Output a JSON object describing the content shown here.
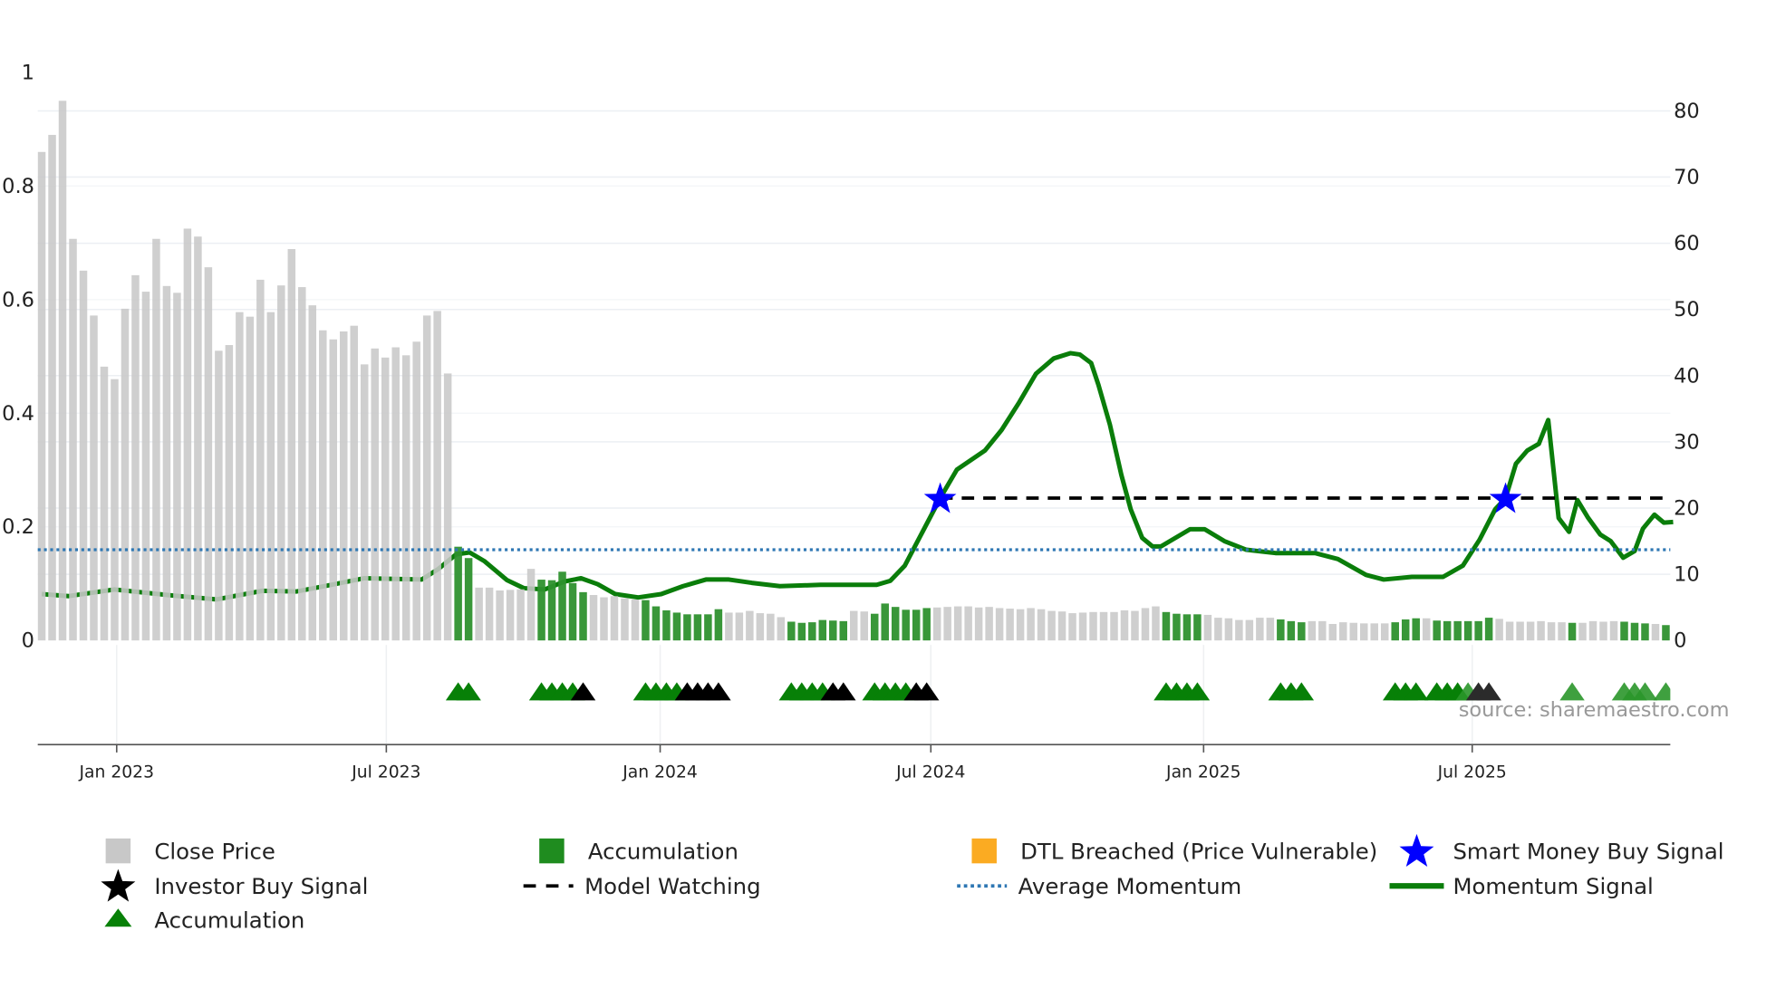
{
  "chart_data": {
    "type": "bar",
    "title": "",
    "left_axis": {
      "range": [
        0,
        1
      ],
      "ticks": [
        0,
        0.2,
        0.4,
        0.6,
        0.8,
        1
      ],
      "tick_labels": [
        "0",
        "0.2",
        "0.4",
        "0.6",
        "0.8",
        "1"
      ]
    },
    "right_axis": {
      "range": [
        0,
        80
      ],
      "ticks": [
        0,
        10,
        20,
        30,
        40,
        50,
        60,
        70,
        80
      ],
      "tick_labels": [
        "0",
        "10",
        "20",
        "30",
        "40",
        "50",
        "60",
        "70",
        "80"
      ]
    },
    "x_axis": {
      "unit": "week index",
      "ticks": [
        {
          "label": "Jan 2023",
          "week": 7.2
        },
        {
          "label": "Jul 2023",
          "week": 33.1
        },
        {
          "label": "Jan 2024",
          "week": 59.4
        },
        {
          "label": "Jul 2024",
          "week": 85.4
        },
        {
          "label": "Jan 2025",
          "week": 111.6
        },
        {
          "label": "Jul 2025",
          "week": 137.4
        }
      ]
    },
    "close_price": [
      0.86,
      0.89,
      0.95,
      0.707,
      0.651,
      0.572,
      0.482,
      0.46,
      0.584,
      0.643,
      0.614,
      0.707,
      0.624,
      0.612,
      0.725,
      0.711,
      0.657,
      0.51,
      0.52,
      0.578,
      0.57,
      0.635,
      0.578,
      0.625,
      0.689,
      0.622,
      0.59,
      0.546,
      0.53,
      0.544,
      0.554,
      0.486,
      0.514,
      0.498,
      0.516,
      0.502,
      0.526,
      0.572,
      0.58,
      0.47,
      0.165,
      0.145,
      0.093,
      0.093,
      0.088,
      0.089,
      0.09,
      0.126,
      0.107,
      0.106,
      0.121,
      0.101,
      0.085,
      0.08,
      0.076,
      0.078,
      0.074,
      0.072,
      0.071,
      0.06,
      0.053,
      0.049,
      0.046,
      0.046,
      0.046,
      0.055,
      0.049,
      0.049,
      0.052,
      0.048,
      0.047,
      0.041,
      0.033,
      0.031,
      0.032,
      0.036,
      0.035,
      0.034,
      0.052,
      0.051,
      0.047,
      0.065,
      0.059,
      0.054,
      0.054,
      0.057,
      0.058,
      0.059,
      0.06,
      0.06,
      0.058,
      0.059,
      0.057,
      0.056,
      0.055,
      0.057,
      0.055,
      0.052,
      0.051,
      0.048,
      0.049,
      0.05,
      0.05,
      0.05,
      0.053,
      0.052,
      0.057,
      0.06,
      0.05,
      0.047,
      0.046,
      0.046,
      0.045,
      0.04,
      0.039,
      0.036,
      0.036,
      0.04,
      0.04,
      0.037,
      0.034,
      0.032,
      0.034,
      0.034,
      0.029,
      0.032,
      0.031,
      0.03,
      0.03,
      0.03,
      0.032,
      0.037,
      0.039,
      0.039,
      0.035,
      0.034,
      0.034,
      0.034,
      0.034,
      0.04,
      0.038,
      0.033,
      0.033,
      0.033,
      0.034,
      0.032,
      0.032,
      0.031,
      0.031,
      0.034,
      0.033,
      0.034,
      0.033,
      0.031,
      0.03,
      0.029,
      0.027
    ],
    "accumulation_weeks": [
      40,
      41,
      48,
      49,
      50,
      51,
      52,
      58,
      59,
      60,
      61,
      62,
      63,
      64,
      65,
      72,
      73,
      74,
      75,
      76,
      77,
      80,
      81,
      82,
      83,
      84,
      85,
      108,
      109,
      110,
      111,
      119,
      120,
      121,
      130,
      131,
      132,
      134,
      135,
      136,
      137,
      138,
      139,
      147,
      152,
      153,
      154,
      156
    ],
    "momentum_signal": [
      [
        0,
        7.0
      ],
      [
        2.6,
        6.7
      ],
      [
        7.0,
        7.7
      ],
      [
        12.5,
        6.8
      ],
      [
        16.8,
        6.2
      ],
      [
        21.2,
        7.5
      ],
      [
        24.5,
        7.4
      ],
      [
        27.8,
        8.4
      ],
      [
        31.0,
        9.4
      ],
      [
        36.5,
        9.2
      ],
      [
        38.1,
        10.8
      ],
      [
        39.8,
        13.0
      ],
      [
        41.1,
        13.3
      ],
      [
        42.5,
        12.0
      ],
      [
        44.7,
        9.1
      ],
      [
        46.3,
        7.9
      ],
      [
        48.3,
        7.7
      ],
      [
        50.2,
        8.9
      ],
      [
        51.8,
        9.4
      ],
      [
        53.4,
        8.5
      ],
      [
        55.1,
        7.0
      ],
      [
        57.3,
        6.5
      ],
      [
        59.5,
        7.0
      ],
      [
        61.6,
        8.2
      ],
      [
        63.8,
        9.2
      ],
      [
        66.0,
        9.2
      ],
      [
        68.2,
        8.7
      ],
      [
        70.9,
        8.2
      ],
      [
        74.8,
        8.4
      ],
      [
        80.2,
        8.4
      ],
      [
        81.5,
        9.0
      ],
      [
        82.9,
        11.3
      ],
      [
        84.6,
        16.4
      ],
      [
        86.3,
        21.5
      ],
      [
        87.9,
        25.8
      ],
      [
        90.6,
        28.7
      ],
      [
        92.2,
        31.8
      ],
      [
        93.9,
        36.0
      ],
      [
        95.5,
        40.3
      ],
      [
        97.2,
        42.6
      ],
      [
        98.8,
        43.4
      ],
      [
        99.7,
        43.2
      ],
      [
        100.8,
        41.9
      ],
      [
        101.5,
        38.6
      ],
      [
        102.6,
        32.6
      ],
      [
        103.7,
        25.0
      ],
      [
        104.6,
        19.8
      ],
      [
        105.7,
        15.5
      ],
      [
        106.7,
        14.2
      ],
      [
        107.5,
        14.2
      ],
      [
        110.3,
        16.8
      ],
      [
        111.7,
        16.8
      ],
      [
        113.6,
        15.0
      ],
      [
        115.7,
        13.7
      ],
      [
        118.5,
        13.2
      ],
      [
        122.3,
        13.2
      ],
      [
        124.5,
        12.3
      ],
      [
        127.2,
        9.9
      ],
      [
        128.9,
        9.2
      ],
      [
        131.6,
        9.6
      ],
      [
        134.6,
        9.6
      ],
      [
        136.5,
        11.3
      ],
      [
        138.1,
        15.2
      ],
      [
        139.6,
        19.8
      ],
      [
        140.6,
        21.5
      ],
      [
        141.6,
        26.7
      ],
      [
        142.7,
        28.7
      ],
      [
        143.8,
        29.7
      ],
      [
        144.7,
        33.3
      ],
      [
        145.7,
        18.5
      ],
      [
        146.7,
        16.4
      ],
      [
        147.5,
        21.2
      ],
      [
        148.5,
        18.6
      ],
      [
        149.7,
        16.0
      ],
      [
        150.7,
        15.0
      ],
      [
        151.9,
        12.5
      ],
      [
        153.0,
        13.5
      ],
      [
        153.8,
        16.9
      ],
      [
        154.9,
        19.0
      ],
      [
        155.8,
        17.8
      ],
      [
        156.7,
        17.9
      ]
    ],
    "average_momentum": 13.7,
    "model_watching": {
      "start_week": 86.3,
      "value": 21.5
    },
    "smart_money_buy_signals": [
      [
        86.3,
        21.5
      ],
      [
        140.6,
        21.5
      ]
    ],
    "accumulation_markers": [
      40,
      41,
      48,
      49,
      50,
      51,
      58,
      59,
      60,
      61,
      72,
      73,
      74,
      75,
      80,
      81,
      82,
      83,
      108,
      109,
      110,
      111,
      119,
      120,
      121,
      130,
      131,
      132,
      134,
      135,
      136,
      137,
      147,
      152,
      153,
      154,
      156
    ],
    "investor_buy_markers": [
      52,
      62,
      63,
      64,
      65,
      76,
      77,
      84,
      85,
      138,
      139
    ],
    "source": "source: sharemaestro.com",
    "legend": [
      {
        "label": "Close Price",
        "icon": "gray-square"
      },
      {
        "label": "Accumulation",
        "icon": "green-square"
      },
      {
        "label": "DTL Breached (Price Vulnerable)",
        "icon": "orange-square"
      },
      {
        "label": "Smart Money Buy Signal",
        "icon": "blue-star"
      },
      {
        "label": "Investor Buy Signal",
        "icon": "black-star"
      },
      {
        "label": "Model Watching",
        "icon": "black-dashed-line"
      },
      {
        "label": "Average Momentum",
        "icon": "blue-dotted-line"
      },
      {
        "label": "Momentum Signal",
        "icon": "green-line"
      },
      {
        "label": "Accumulation",
        "icon": "green-triangle"
      }
    ]
  },
  "colors": {
    "close_price": "#c8c8c8",
    "accumulation": "#2e912e",
    "dtl_breached": "#fbab22",
    "smart_money": "#0000ff",
    "investor_buy": "#000000",
    "momentum": "#0a7d0a",
    "average_momentum": "#2e77b3",
    "model_watching": "#000000"
  }
}
